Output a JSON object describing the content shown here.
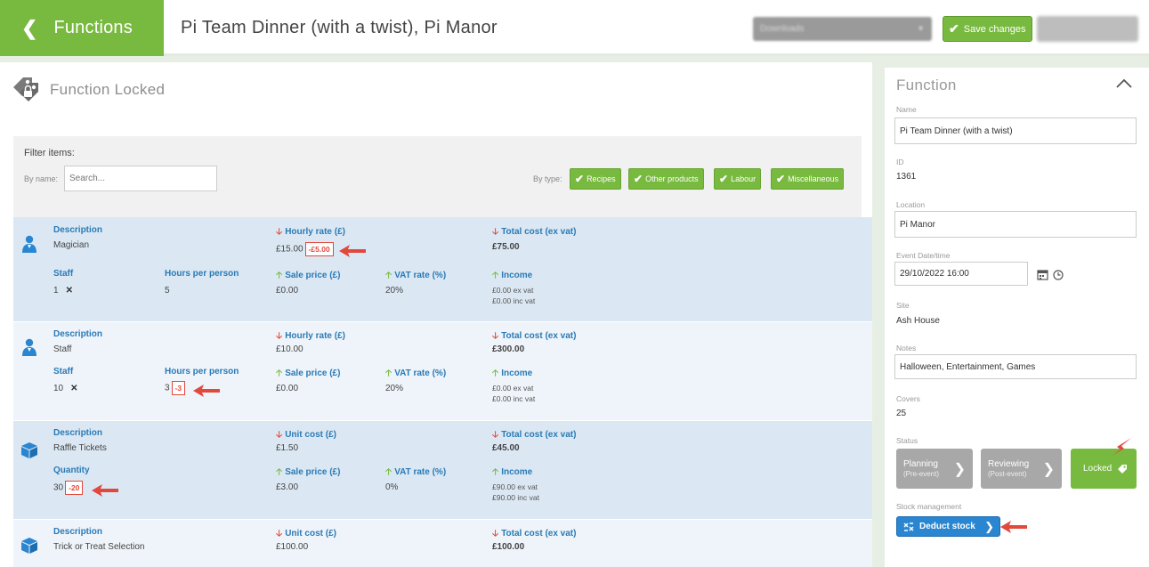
{
  "header": {
    "back_label": "Functions",
    "title": "Pi Team Dinner (with a twist), Pi Manor",
    "blurred_select_text": "Downloads",
    "save_label": "Save changes"
  },
  "locked": {
    "title": "Function Locked"
  },
  "filter": {
    "label": "Filter items:",
    "by_name_label": "By name:",
    "search_placeholder": "Search...",
    "by_type_label": "By type:",
    "types": [
      "Recipes",
      "Other products",
      "Labour",
      "Miscellaneous"
    ]
  },
  "items": [
    {
      "kind": "labour",
      "description_header": "Description",
      "description": "Magician",
      "rate_header": "Hourly rate (£)",
      "rate": "£15.00",
      "rate_change": "-£5.00",
      "total_header": "Total cost (ex vat)",
      "total": "£75.00",
      "qty_header": "Staff",
      "qty": "1",
      "hours_header": "Hours per person",
      "hours": "5",
      "sale_header": "Sale price (£)",
      "sale": "£0.00",
      "vat_header": "VAT rate (%)",
      "vat": "20%",
      "income_header": "Income",
      "income_ex": "£0.00 ex vat",
      "income_inc": "£0.00 inc vat"
    },
    {
      "kind": "labour",
      "description_header": "Description",
      "description": "Staff",
      "rate_header": "Hourly rate (£)",
      "rate": "£10.00",
      "total_header": "Total cost (ex vat)",
      "total": "£300.00",
      "qty_header": "Staff",
      "qty": "10",
      "hours_header": "Hours per person",
      "hours": "3",
      "hours_change": "-3",
      "sale_header": "Sale price (£)",
      "sale": "£0.00",
      "vat_header": "VAT rate (%)",
      "vat": "20%",
      "income_header": "Income",
      "income_ex": "£0.00 ex vat",
      "income_inc": "£0.00 inc vat"
    },
    {
      "kind": "product",
      "description_header": "Description",
      "description": "Raffle Tickets",
      "rate_header": "Unit cost (£)",
      "rate": "£1.50",
      "total_header": "Total cost (ex vat)",
      "total": "£45.00",
      "qty_header": "Quantity",
      "qty": "30",
      "qty_change": "-20",
      "sale_header": "Sale price (£)",
      "sale": "£3.00",
      "vat_header": "VAT rate (%)",
      "vat": "0%",
      "income_header": "Income",
      "income_ex": "£90.00 ex vat",
      "income_inc": "£90.00 inc vat"
    },
    {
      "kind": "product",
      "description_header": "Description",
      "description": "Trick or Treat Selection",
      "rate_header": "Unit cost (£)",
      "rate": "£100.00",
      "total_header": "Total cost (ex vat)",
      "total": "£100.00"
    }
  ],
  "function_panel": {
    "title": "Function",
    "name_label": "Name",
    "name": "Pi Team Dinner (with a twist)",
    "id_label": "ID",
    "id": "1361",
    "location_label": "Location",
    "location": "Pi Manor",
    "event_label": "Event Date/time",
    "event_datetime": "29/10/2022 16:00",
    "site_label": "Site",
    "site": "Ash House",
    "notes_label": "Notes",
    "notes": "Halloween, Entertainment, Games",
    "covers_label": "Covers",
    "covers": "25",
    "status_label": "Status",
    "status_planning": "Planning",
    "status_planning_sub": "(Pre-event)",
    "status_reviewing": "Reviewing",
    "status_reviewing_sub": "(Post-event)",
    "status_locked": "Locked",
    "stock_label": "Stock management",
    "deduct_label": "Deduct stock"
  },
  "colors": {
    "green": "#78b93f",
    "blue": "#2a86d0",
    "header_blue": "#2a7ab6",
    "red": "#e2483c",
    "grey_status": "#a8a8a8",
    "row_blue": "#dbe8f3",
    "row_light": "#eef4f9"
  }
}
